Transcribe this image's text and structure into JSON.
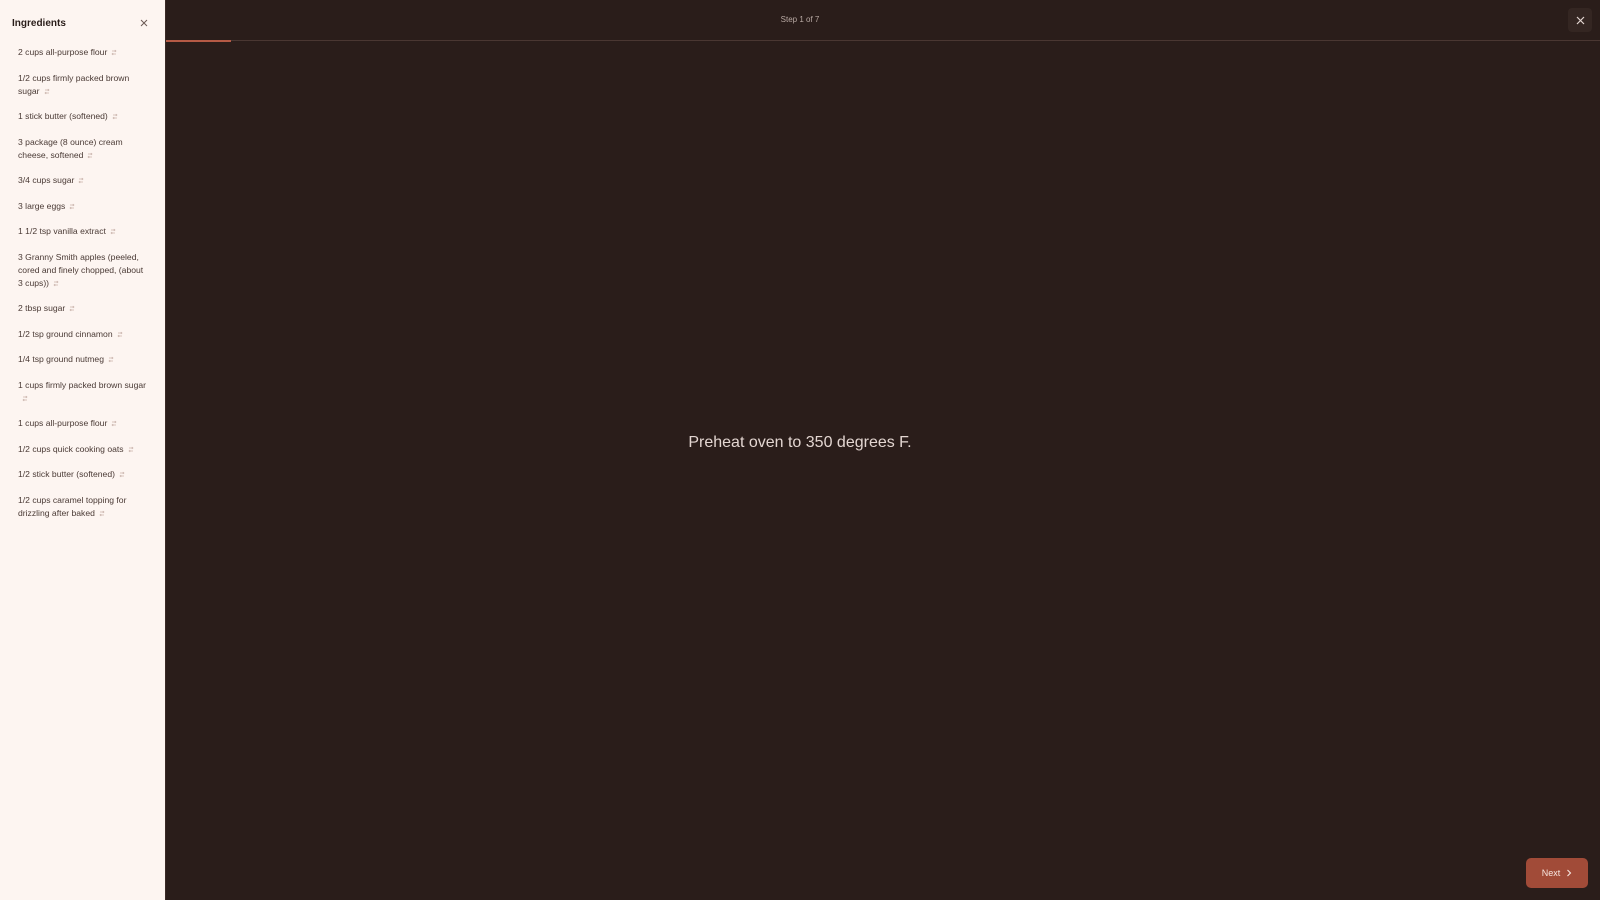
{
  "sidebar": {
    "title": "Ingredients",
    "ingredients": [
      "2 cups all-purpose flour",
      "1/2 cups firmly packed brown sugar",
      "1 stick butter (softened)",
      "3 package (8 ounce) cream cheese, softened",
      "3/4 cups sugar",
      "3 large eggs",
      "1 1/2 tsp vanilla extract",
      "3 Granny Smith apples (peeled, cored and finely chopped, (about 3 cups))",
      "2 tbsp sugar",
      "1/2 tsp ground cinnamon",
      "1/4 tsp ground nutmeg",
      "1 cups firmly packed brown sugar",
      "1 cups all-purpose flour",
      "1/2 cups quick cooking oats",
      "1/2 stick butter (softened)",
      "1/2 cups caramel topping for drizzling after baked"
    ]
  },
  "step": {
    "label": "Step 1 of 7",
    "current": 1,
    "total": 7,
    "text": "Preheat oven to 350 degrees F."
  },
  "next_button": {
    "label": "Next"
  },
  "icons": {
    "sidebar_close": "close-icon",
    "exit": "close-icon",
    "ingredient": "swap-icon",
    "next": "chevron-right-icon"
  },
  "colors": {
    "background": "#2a1d1a",
    "sidebar": "#fdf5f1",
    "accent": "#b55a45",
    "button": "#a14b38"
  }
}
